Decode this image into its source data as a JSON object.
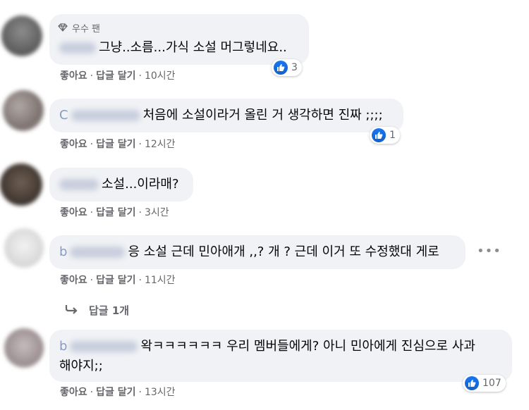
{
  "comments": [
    {
      "badge": "우수 팬",
      "text": "그냥..소름...가식 소설 머그렇네요..",
      "actions": {
        "like": "좋아요",
        "reply": "답글 달기",
        "time": "10시간"
      },
      "reaction_count": "3"
    },
    {
      "prefix": "C",
      "text": "처음에 소설이라거 올린 거 생각하면 진짜 ;;;;",
      "actions": {
        "like": "좋아요",
        "reply": "답글 달기",
        "time": "12시간"
      },
      "reaction_count": "1"
    },
    {
      "text": "소설...이라매?",
      "actions": {
        "like": "좋아요",
        "reply": "답글 달기",
        "time": "3시간"
      }
    },
    {
      "prefix": "b",
      "text": "응 소설 근데 민아애개 ,,? 개 ? 근데 이거 또 수정했대 게로",
      "actions": {
        "like": "좋아요",
        "reply": "답글 달기",
        "time": "11시간"
      },
      "replies_label": "답글 1개"
    },
    {
      "prefix": "b",
      "text_line1": "왁ㅋㅋㅋㅋㅋㅋ 우리 멤버들에게? 아니 민아에게 진심으로 사과",
      "text_line2": "해야지;;",
      "actions": {
        "like": "좋아요",
        "reply": "답글 달기",
        "time": "13시간"
      },
      "reaction_count": "107"
    }
  ],
  "separator": "·",
  "colors": {
    "like_blue": "#1877f2",
    "bubble_bg": "#f0f2f5",
    "meta_gray": "#65676b"
  }
}
